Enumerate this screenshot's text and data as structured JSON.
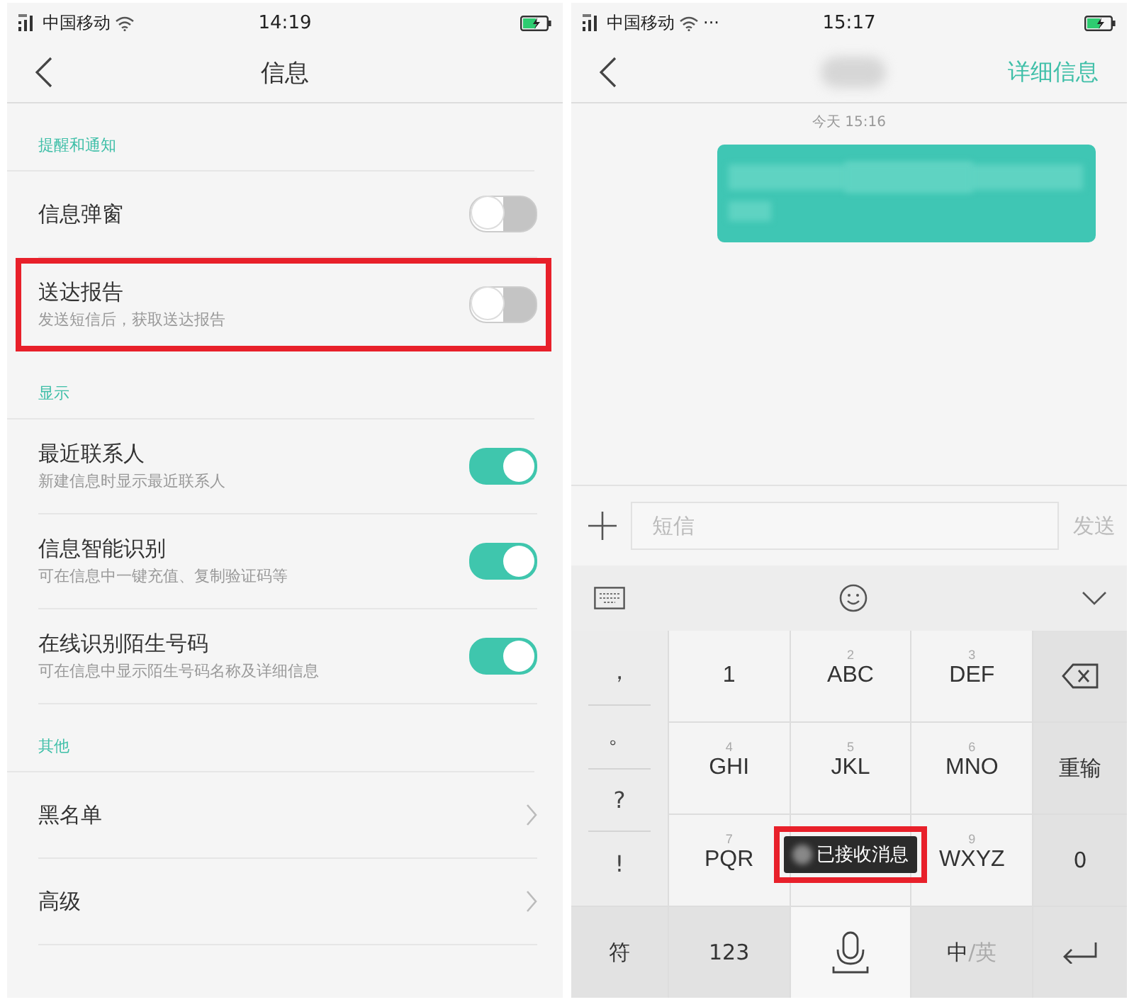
{
  "left_screen": {
    "status_bar": {
      "carrier": "中国移动",
      "time": "14:19"
    },
    "header": {
      "title": "信息"
    },
    "sections": [
      {
        "title": "提醒和通知",
        "items": [
          {
            "kind": "toggle",
            "label": "信息弹窗",
            "on": false,
            "highlighted": false
          },
          {
            "kind": "toggle",
            "label": "送达报告",
            "subtitle": "发送短信后，获取送达报告",
            "on": false,
            "highlighted": true
          }
        ]
      },
      {
        "title": "显示",
        "items": [
          {
            "kind": "toggle",
            "label": "最近联系人",
            "subtitle": "新建信息时显示最近联系人",
            "on": true,
            "highlighted": false
          },
          {
            "kind": "toggle",
            "label": "信息智能识别",
            "subtitle": "可在信息中一键充值、复制验证码等",
            "on": true,
            "highlighted": false
          },
          {
            "kind": "toggle",
            "label": "在线识别陌生号码",
            "subtitle": "可在信息中显示陌生号码名称及详细信息",
            "on": true,
            "highlighted": false
          }
        ]
      },
      {
        "title": "其他",
        "items": [
          {
            "kind": "link",
            "label": "黑名单",
            "highlighted": false
          },
          {
            "kind": "link",
            "label": "高级",
            "highlighted": false
          }
        ]
      }
    ]
  },
  "right_screen": {
    "status_bar": {
      "carrier": "中国移动",
      "more": "···",
      "time": "15:17"
    },
    "header": {
      "action": "详细信息"
    },
    "messages": {
      "timestamp": "今天 15:16"
    },
    "composer": {
      "placeholder": "短信",
      "send": "发送"
    },
    "keyboard": {
      "symbols": [
        "，",
        "。",
        "?",
        "!"
      ],
      "rows": [
        [
          {
            "kind": "key",
            "label": "1"
          },
          {
            "kind": "key",
            "digit": "2",
            "label": "ABC"
          },
          {
            "kind": "key",
            "digit": "3",
            "label": "DEF"
          },
          {
            "kind": "backspace"
          }
        ],
        [
          {
            "kind": "key",
            "digit": "4",
            "label": "GHI"
          },
          {
            "kind": "key",
            "digit": "5",
            "label": "JKL"
          },
          {
            "kind": "key",
            "digit": "6",
            "label": "MNO"
          },
          {
            "kind": "fn",
            "label": "重输"
          }
        ],
        [
          {
            "kind": "key",
            "digit": "7",
            "label": "PQR"
          },
          {
            "kind": "key"
          },
          {
            "kind": "key",
            "digit": "9",
            "label": "WXYZ"
          },
          {
            "kind": "fn",
            "label": "0"
          }
        ]
      ],
      "bottom": [
        {
          "kind": "fn",
          "label": "符"
        },
        {
          "kind": "fn",
          "label": "123"
        },
        {
          "kind": "mic"
        },
        {
          "kind": "fn",
          "label": "中",
          "alt": "/英"
        },
        {
          "kind": "enter"
        }
      ]
    },
    "toast": {
      "text": "已接收消息",
      "highlighted": true
    }
  }
}
